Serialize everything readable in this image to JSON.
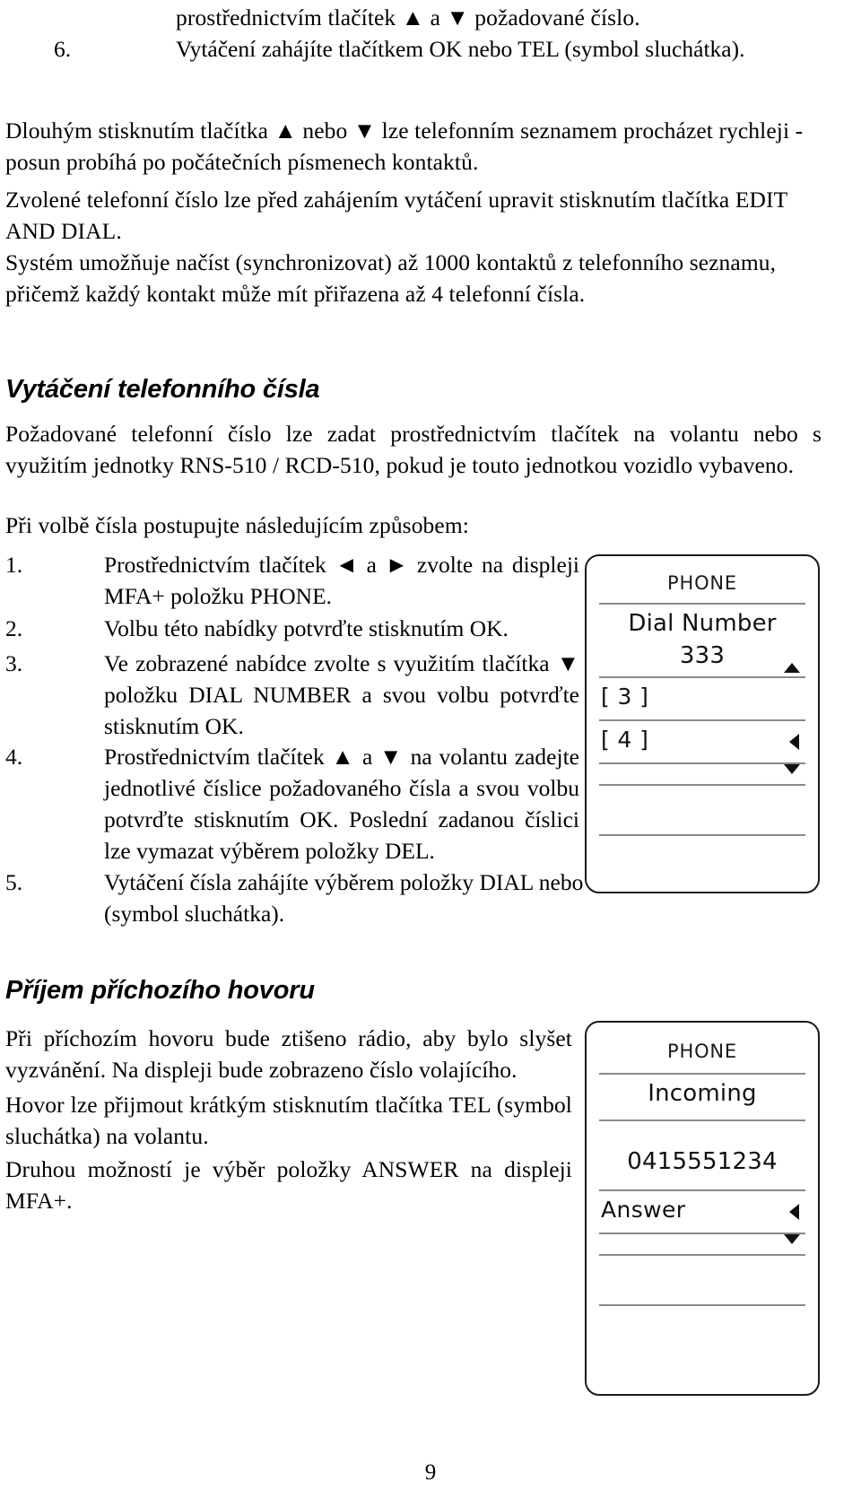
{
  "document": {
    "language": "cs",
    "page_number": "9"
  },
  "blocks": {
    "cont_line": "prostřednictvím tlačítek ▲ a ▼ požadované číslo.",
    "item6_num": "6.",
    "item6_text": "Vytáčení zahájíte tlačítkem OK nebo TEL (symbol sluchátka).",
    "p_long_press": "Dlouhým stisknutím tlačítka ▲ nebo ▼ lze telefonním seznamem procházet rychleji - posun probíhá po počátečních písmenech kontaktů.",
    "p_edit_dial": "Zvolené telefonní číslo lze před zahájením vytáčení upravit stisknutím tlačítka EDIT AND DIAL.",
    "p_sync": "Systém umožňuje načíst (synchronizovat) až 1000 kontaktů z telefonního seznamu, přičemž každý kontakt může mít přiřazena až 4 telefonní čísla."
  },
  "section_dial": {
    "heading": "Vytáčení telefonního čísla",
    "intro": "Požadované telefonní číslo lze zadat prostřednictvím tlačítek na volantu nebo s využitím jednotky RNS-510 / RCD-510, pokud je touto jednotkou vozidlo vybaveno.",
    "lead_in": "Při volbě čísla postupujte následujícím způsobem:",
    "steps": [
      {
        "num": "1.",
        "text": "Prostřednictvím tlačítek ◄ a ► zvolte na displeji MFA+ položku PHONE."
      },
      {
        "num": "2.",
        "text": "Volbu této nabídky potvrďte stisknutím OK."
      },
      {
        "num": "3.",
        "text": "Ve zobrazené nabídce zvolte s využitím tlačítka ▼ položku DIAL NUMBER a svou volbu potvrďte stisknutím OK."
      },
      {
        "num": "4.",
        "text": "Prostřednictvím tlačítek ▲ a ▼ na volantu zadejte jednotlivé číslice požadovaného čísla a svou volbu potvrďte stisknutím OK. Poslední zadanou číslici lze vymazat výběrem položky DEL."
      },
      {
        "num": "5.",
        "text": "Vytáčení čísla zahájíte výběrem položky DIAL nebo stisknutím tlačítka TEL (symbol sluchátka)."
      }
    ]
  },
  "section_incoming": {
    "heading": "Příjem příchozího hovoru",
    "p1": "Při příchozím hovoru bude ztišeno rádio, aby bylo slyšet vyzvánění. Na displeji bude zobrazeno číslo volajícího.",
    "p2": "Hovor lze přijmout krátkým stisknutím tlačítka TEL (symbol sluchátka) na volantu.",
    "p3": "Druhou možností je výběr položky ANSWER na displeji MFA+."
  },
  "display_dial": {
    "title": "PHONE",
    "line_menu": "Dial Number",
    "line_value": "333",
    "row_3": "[ 3 ]",
    "row_4": "[ 4 ]",
    "glyph_up": "up-triangle-icon",
    "glyph_left": "left-triangle-icon",
    "glyph_down": "down-triangle-icon"
  },
  "display_incoming": {
    "title": "PHONE",
    "line_state": "Incoming",
    "line_number": "0415551234",
    "row_answer": "Answer",
    "glyph_left": "left-triangle-icon",
    "glyph_down": "down-triangle-icon"
  }
}
